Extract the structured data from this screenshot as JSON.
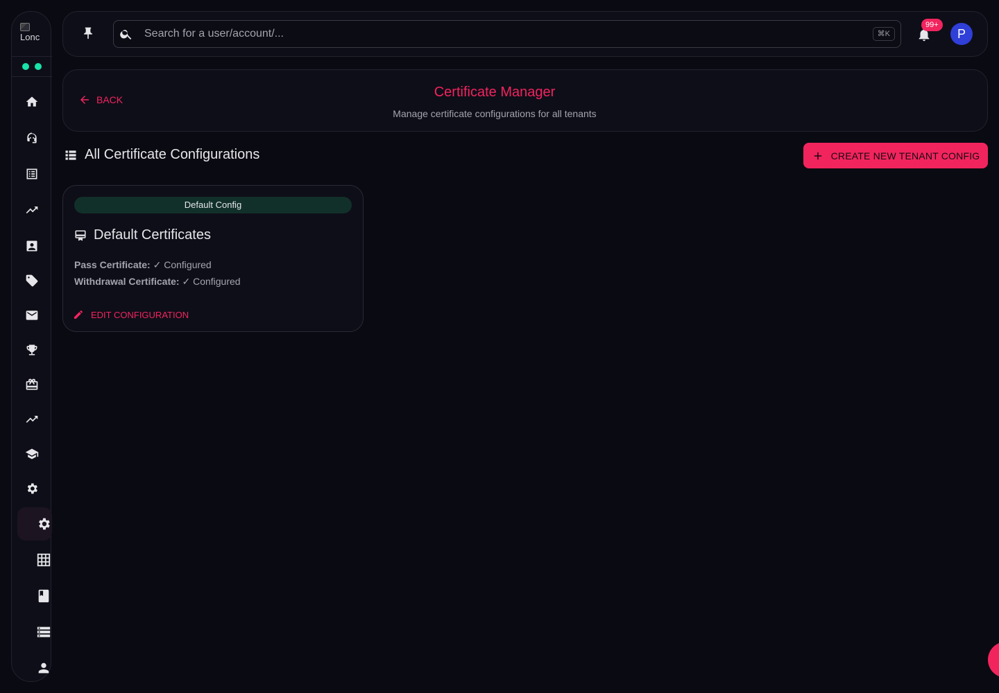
{
  "sidebar": {
    "logo_alt": "Lonc",
    "items": [
      {
        "icon": "home-icon"
      },
      {
        "icon": "support-agent-icon"
      },
      {
        "icon": "list-alt-icon"
      },
      {
        "icon": "trending-up-icon"
      },
      {
        "icon": "contact-card-icon"
      },
      {
        "icon": "tag-icon"
      },
      {
        "icon": "mail-icon"
      },
      {
        "icon": "trophy-icon"
      },
      {
        "icon": "card-giftcard-icon"
      },
      {
        "icon": "trending-up-icon"
      },
      {
        "icon": "school-icon"
      },
      {
        "icon": "settings-icon"
      },
      {
        "icon": "settings-icon",
        "active": true
      },
      {
        "icon": "grid-icon"
      },
      {
        "icon": "book-icon"
      },
      {
        "icon": "storage-icon"
      },
      {
        "icon": "person-icon"
      }
    ]
  },
  "topbar": {
    "search_placeholder": "Search for a user/account/...",
    "shortcut": "⌘K",
    "notifications_badge": "99+",
    "avatar_initial": "P"
  },
  "header": {
    "back_label": "BACK",
    "title": "Certificate Manager",
    "subtitle": "Manage certificate configurations for all tenants"
  },
  "section": {
    "title": "All Certificate Configurations",
    "create_button": "CREATE NEW TENANT CONFIG"
  },
  "configs": [
    {
      "badge": "Default Config",
      "title": "Default Certificates",
      "pass_label": "Pass Certificate:",
      "pass_value": "✓ Configured",
      "withdrawal_label": "Withdrawal Certificate:",
      "withdrawal_value": "✓ Configured",
      "edit_label": "EDIT CONFIGURATION"
    }
  ],
  "colors": {
    "accent": "#f2245e",
    "background": "#0a0a12",
    "surface": "#0e0e18",
    "status_dot": "#19e3a8",
    "badge_bg": "#12302a",
    "avatar_bg": "#2f3fd8"
  }
}
